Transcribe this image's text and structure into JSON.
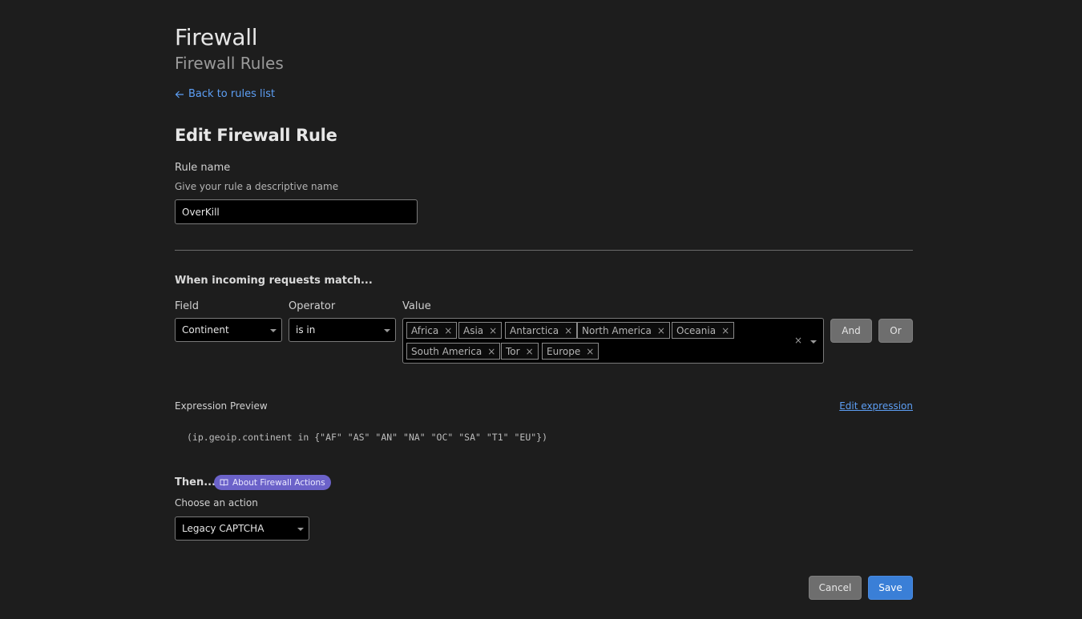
{
  "header": {
    "title": "Firewall",
    "subtitle": "Firewall Rules",
    "back_link": "Back to rules list",
    "back_icon": "arrow-left-icon"
  },
  "form": {
    "title": "Edit Firewall Rule",
    "rule_name": {
      "label": "Rule name",
      "help": "Give your rule a descriptive name",
      "value": "OverKill"
    },
    "match": {
      "heading": "When incoming requests match...",
      "field_label": "Field",
      "field_value": "Continent",
      "operator_label": "Operator",
      "operator_value": "is in",
      "value_label": "Value",
      "values": [
        "Africa",
        "Asia",
        "Antarctica",
        "North America",
        "Oceania",
        "South America",
        "Tor",
        "Europe"
      ],
      "remove_glyph": "×",
      "clear_glyph": "×",
      "and_label": "And",
      "or_label": "Or"
    },
    "expression": {
      "label": "Expression Preview",
      "edit_link": "Edit expression",
      "text": "(ip.geoip.continent in {\"AF\" \"AS\" \"AN\" \"NA\" \"OC\" \"SA\" \"T1\" \"EU\"})"
    },
    "action": {
      "heading": "Then...",
      "badge": "About Firewall Actions",
      "badge_icon": "book-icon",
      "label": "Choose an action",
      "value": "Legacy CAPTCHA"
    },
    "buttons": {
      "cancel": "Cancel",
      "save": "Save"
    }
  },
  "colors": {
    "background": "#1d1d1d",
    "link": "#5d9ff5",
    "primary": "#3a7fd7",
    "badge": "#6b62c9"
  }
}
